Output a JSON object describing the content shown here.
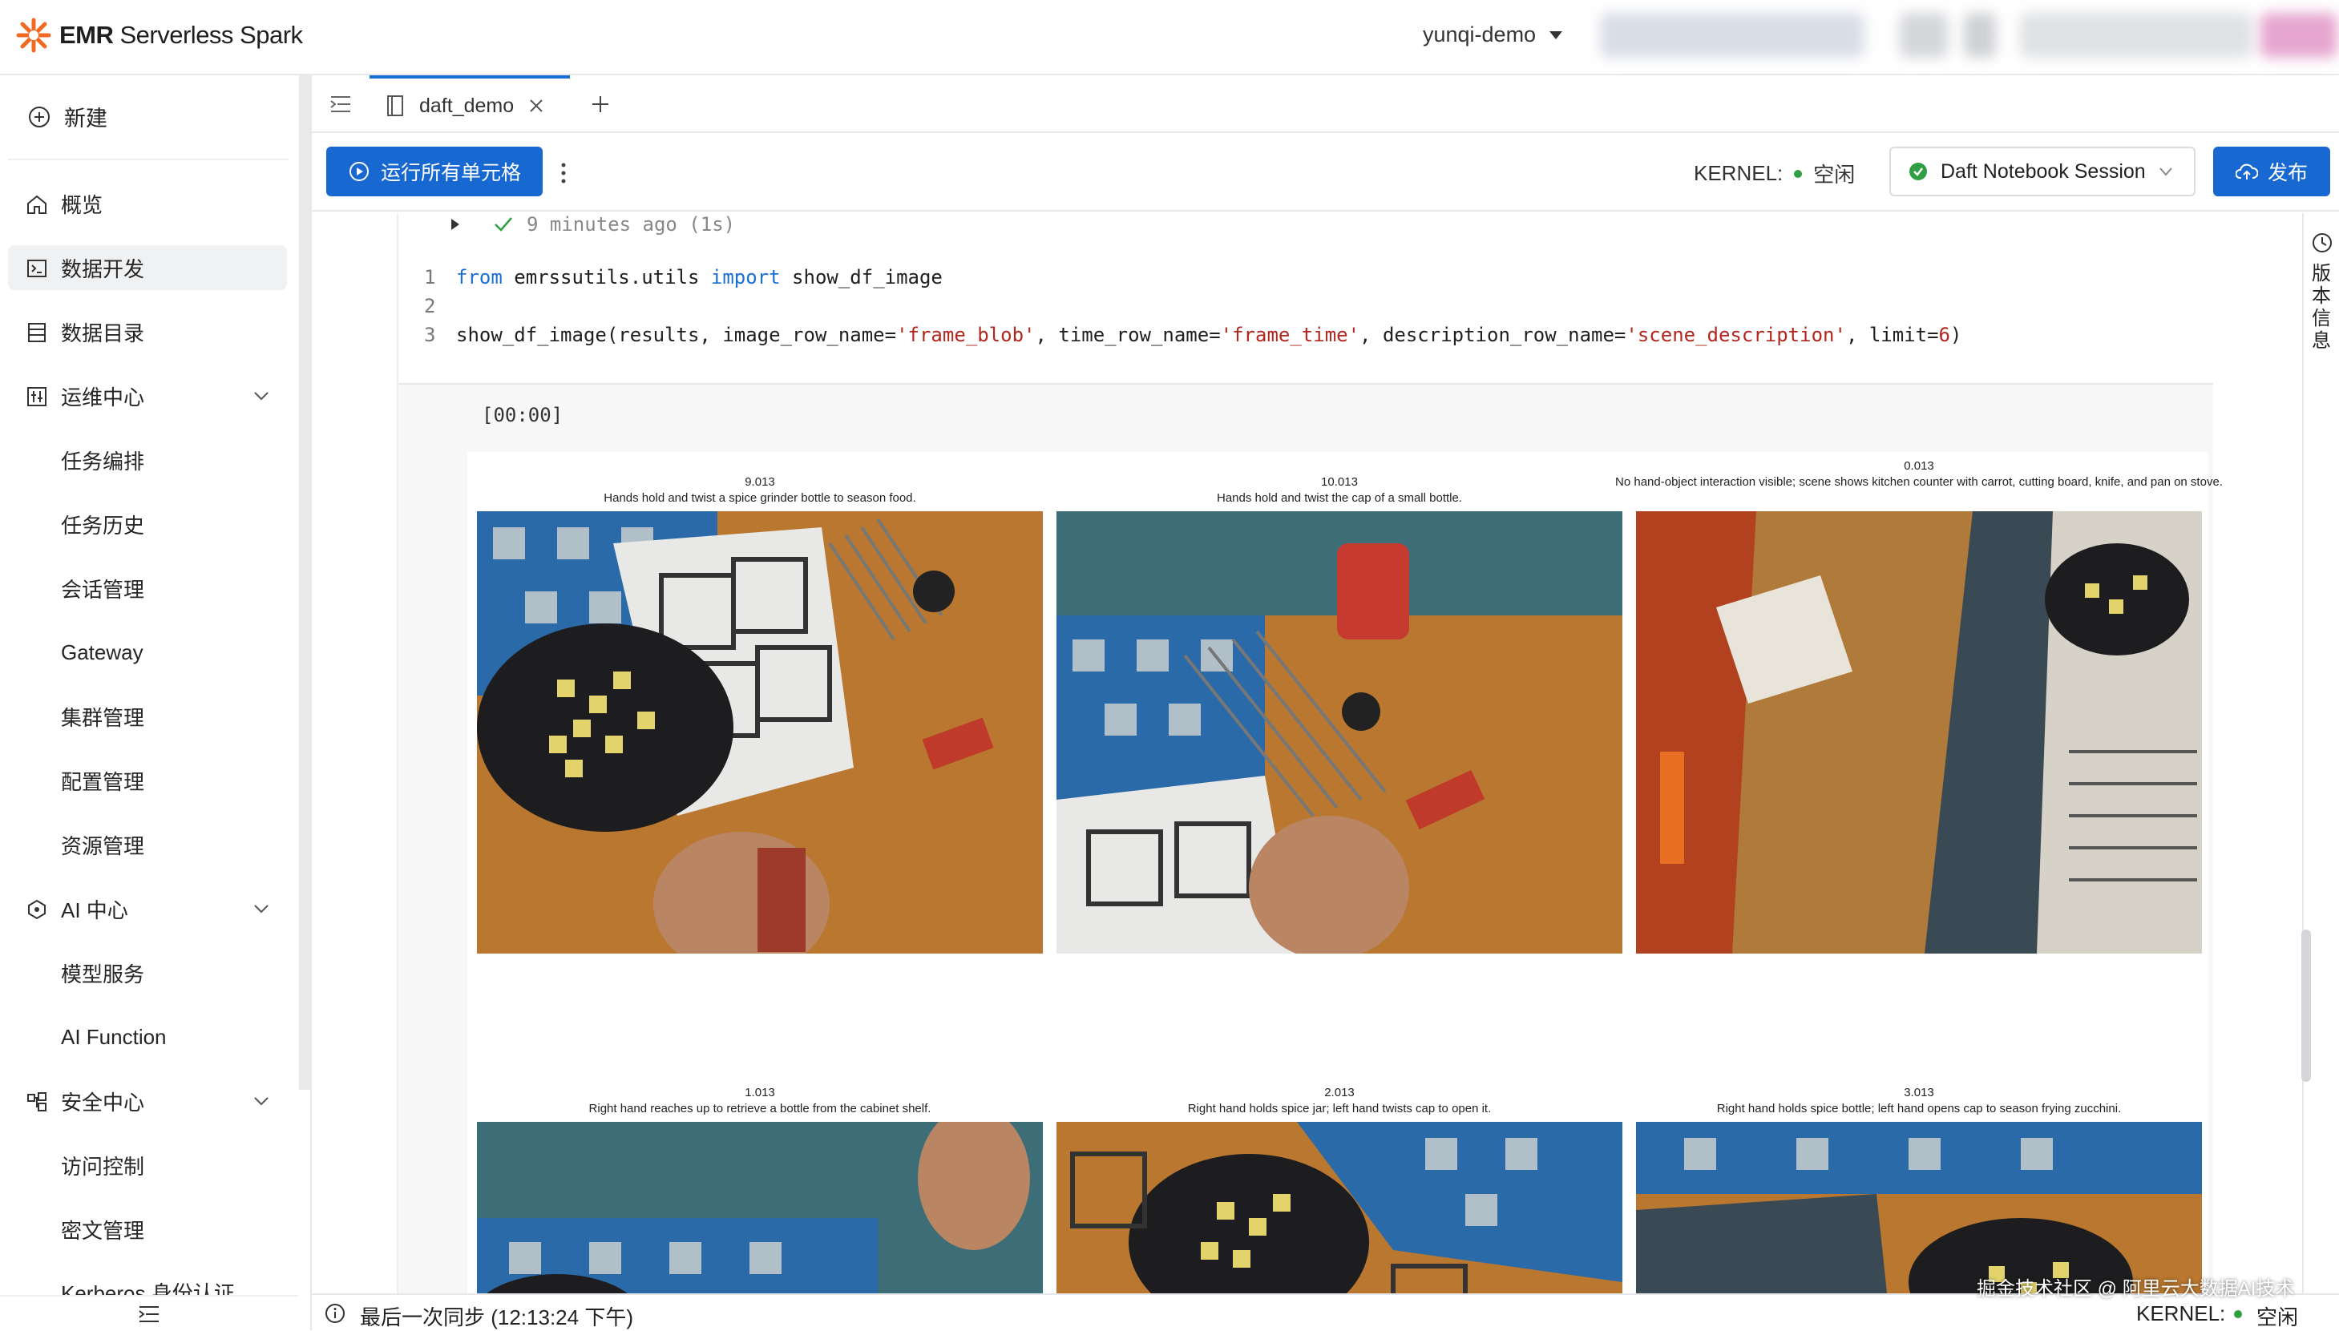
{
  "app": {
    "title_bold": "EMR",
    "title_rest": " Serverless Spark",
    "workspace": "yunqi-demo"
  },
  "sidebar": {
    "new_label": "新建",
    "items": [
      {
        "label": "概览",
        "icon": "home-icon"
      },
      {
        "label": "数据开发",
        "icon": "terminal-icon"
      },
      {
        "label": "数据目录",
        "icon": "catalog-icon"
      },
      {
        "label": "运维中心",
        "icon": "ops-icon"
      },
      {
        "label": "任务编排"
      },
      {
        "label": "任务历史"
      },
      {
        "label": "会话管理"
      },
      {
        "label": "Gateway"
      },
      {
        "label": "集群管理"
      },
      {
        "label": "配置管理"
      },
      {
        "label": "资源管理"
      },
      {
        "label": "AI 中心",
        "icon": "ai-icon"
      },
      {
        "label": "模型服务"
      },
      {
        "label": "AI Function"
      },
      {
        "label": "安全中心",
        "icon": "security-icon"
      },
      {
        "label": "访问控制"
      },
      {
        "label": "密文管理"
      },
      {
        "label": "Kerberos 身份认证"
      }
    ]
  },
  "tabs": [
    {
      "label": "daft_demo"
    }
  ],
  "toolbar": {
    "run_all": "运行所有单元格",
    "kernel_label": "KERNEL:",
    "kernel_state": "空闲",
    "session": "Daft Notebook Session",
    "publish": "发布"
  },
  "cell": {
    "status": "9 minutes ago (1s)",
    "line_numbers": [
      "1",
      "2",
      "3"
    ],
    "code1_kw_from": "from",
    "code1_mod": " emrssutils.utils ",
    "code1_kw_import": "import",
    "code1_name": " show_df_image",
    "code3_a": "show_df_image(results, image_row_name=",
    "code3_s1": "'frame_blob'",
    "code3_b": ", time_row_name=",
    "code3_s2": "'frame_time'",
    "code3_c": ", description_row_name=",
    "code3_s3": "'scene_description'",
    "code3_d": ", limit=",
    "code3_n": "6",
    "code3_e": ")"
  },
  "output": {
    "label": "[00:00]",
    "frames": [
      {
        "time": "9.013",
        "desc": "Hands hold and twist a spice grinder bottle to season food."
      },
      {
        "time": "10.013",
        "desc": "Hands hold and twist the cap of a small bottle."
      },
      {
        "time": "0.013",
        "desc": "No hand-object interaction visible; scene shows kitchen counter with carrot, cutting board, knife, and pan on stove."
      },
      {
        "time": "1.013",
        "desc": "Right hand reaches up to retrieve a bottle from the cabinet shelf."
      },
      {
        "time": "2.013",
        "desc": "Right hand holds spice jar; left hand twists cap to open it."
      },
      {
        "time": "3.013",
        "desc": "Right hand holds spice bottle; left hand opens cap to season frying zucchini."
      }
    ]
  },
  "rightpanel": {
    "label": "版本信息"
  },
  "statusbar": {
    "sync": "最后一次同步 (12:13:24 下午)",
    "kernel_label": "KERNEL:",
    "kernel_state": "空闲"
  },
  "watermark": "掘金技术社区 @ 阿里云大数据AI技术",
  "colors": {
    "accent": "#1768d1",
    "brand_orange": "#f26a21",
    "ok_green": "#2ea043"
  }
}
